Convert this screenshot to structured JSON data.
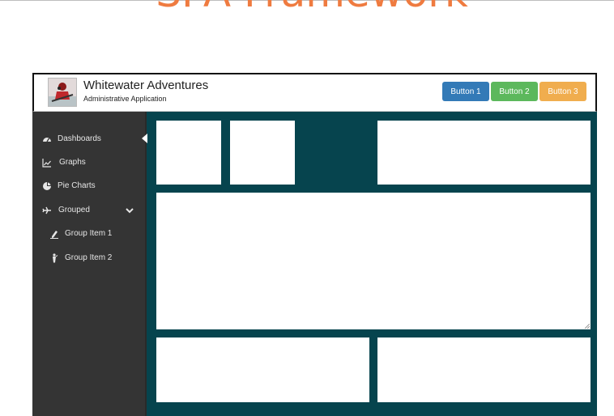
{
  "page": {
    "heading": "SPA Framework"
  },
  "header": {
    "title": "Whitewater Adventures",
    "subtitle": "Administrative Application",
    "buttons": [
      {
        "label": "Button 1",
        "color": "#337ab7"
      },
      {
        "label": "Button 2",
        "color": "#5cb85c"
      },
      {
        "label": "Button 3",
        "color": "#f0ad4e"
      }
    ]
  },
  "sidebar": {
    "items": [
      {
        "label": "Dashboards",
        "icon": "dashboard-icon"
      },
      {
        "label": "Graphs",
        "icon": "line-chart-icon"
      },
      {
        "label": "Pie Charts",
        "icon": "pie-chart-icon"
      },
      {
        "label": "Grouped",
        "icon": "plane-icon",
        "expanded": true
      },
      {
        "label": "Group Item 1",
        "icon": "pencil-icon"
      },
      {
        "label": "Group Item 2",
        "icon": "person-icon"
      }
    ]
  },
  "colors": {
    "accent_title": "#ef7b40",
    "content_background": "#06444e",
    "sidebar_background": "#343434"
  }
}
